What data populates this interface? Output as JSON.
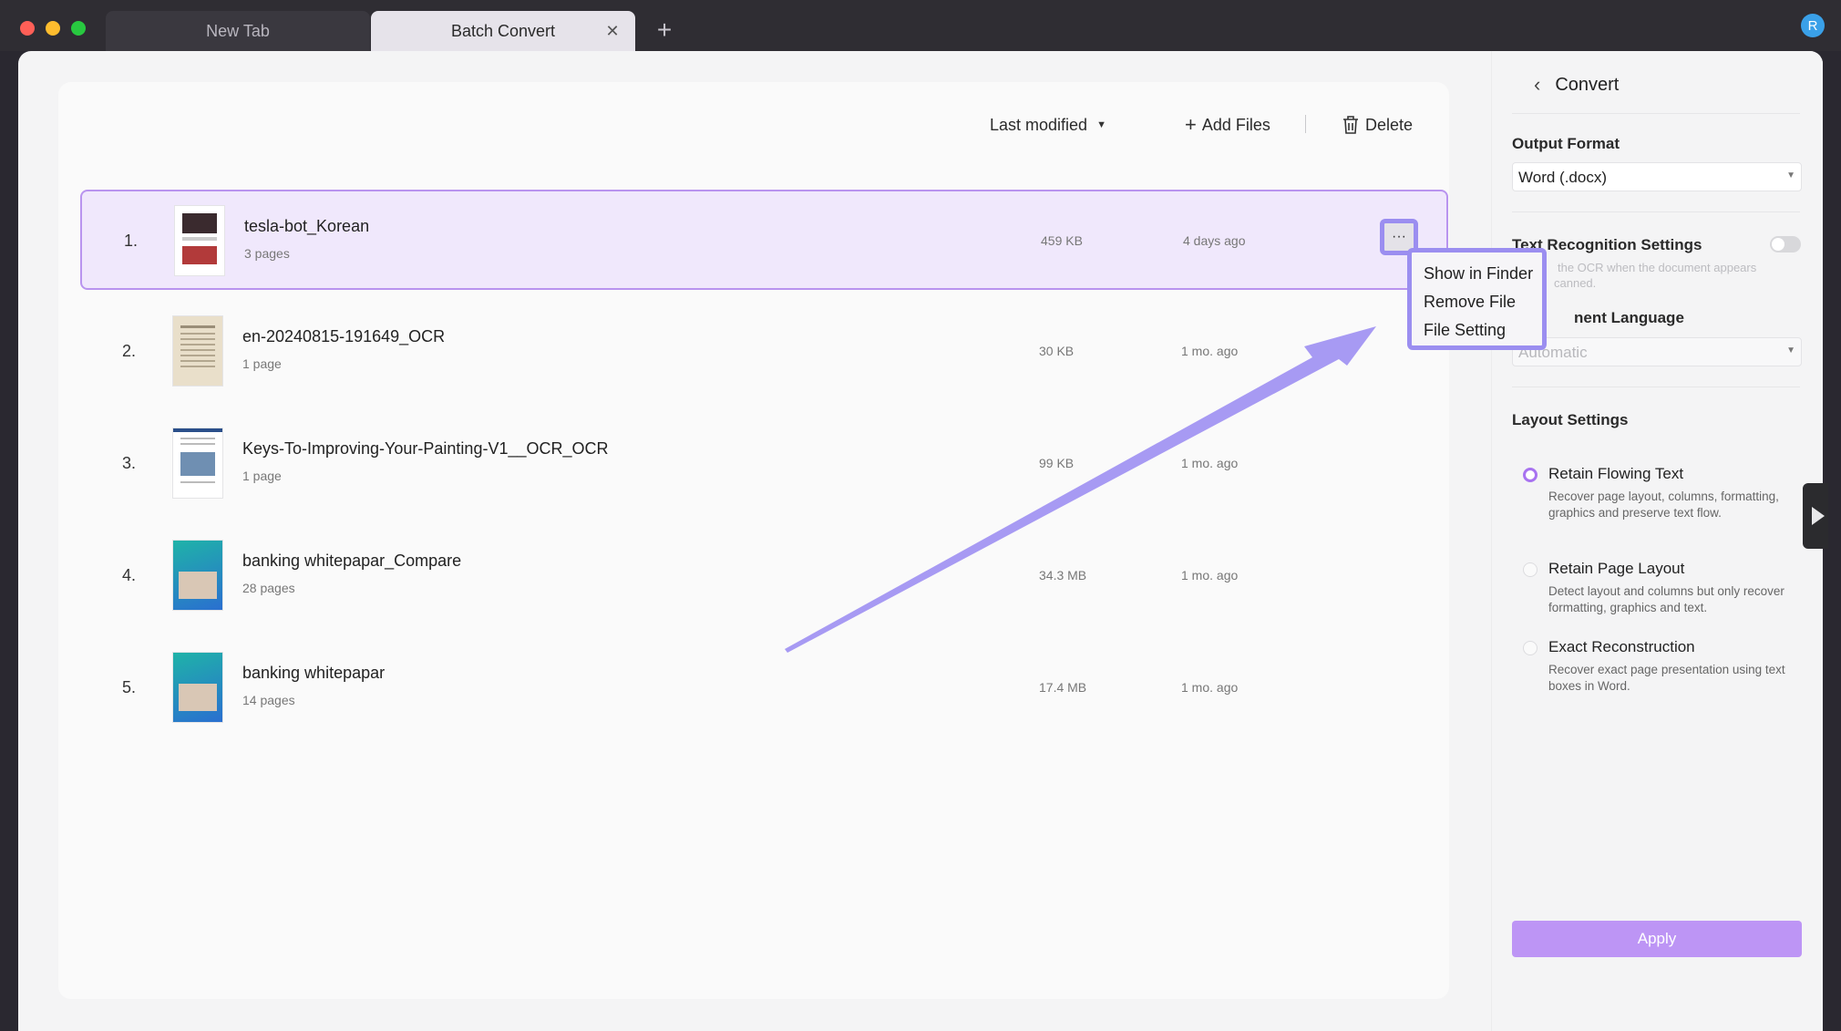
{
  "tabs": [
    {
      "label": "New Tab"
    },
    {
      "label": "Batch Convert",
      "close": "✕"
    }
  ],
  "new_tab": "+",
  "avatar": "R",
  "toolbar": {
    "sort_label": "Last modified",
    "add_files_label": "Add Files",
    "delete_label": "Delete"
  },
  "files": [
    {
      "num": "1.",
      "name": "tesla-bot_Korean",
      "pages": "3 pages",
      "size": "459 KB",
      "date": "4 days ago"
    },
    {
      "num": "2.",
      "name": "en-20240815-191649_OCR",
      "pages": "1 page",
      "size": "30 KB",
      "date": "1 mo. ago"
    },
    {
      "num": "3.",
      "name": "Keys-To-Improving-Your-Painting-V1__OCR_OCR",
      "pages": "1 page",
      "size": "99 KB",
      "date": "1 mo. ago"
    },
    {
      "num": "4.",
      "name": "banking whitepapar_Compare",
      "pages": "28 pages",
      "size": "34.3 MB",
      "date": "1 mo. ago"
    },
    {
      "num": "5.",
      "name": "banking whitepapar",
      "pages": "14 pages",
      "size": "17.4 MB",
      "date": "1 mo. ago"
    }
  ],
  "more_button": "···",
  "context_menu": [
    "Show in Finder",
    "Remove File",
    "File Setting"
  ],
  "side": {
    "title": "Convert",
    "output_format_label": "Output Format",
    "output_format_value": "Word (.docx)",
    "ocr_label": "Text Recognition Settings",
    "ocr_hint_line1": "the OCR when the document appears",
    "ocr_hint_line2": "canned.",
    "language_label": "nent Language",
    "language_value": "Automatic",
    "layout_label": "Layout Settings",
    "options": [
      {
        "title": "Retain Flowing Text",
        "desc": "Recover page layout, columns, formatting, graphics and preserve text flow.",
        "checked": true
      },
      {
        "title": "Retain Page Layout",
        "desc": "Detect layout and columns but only recover formatting, graphics and text.",
        "checked": false
      },
      {
        "title": "Exact Reconstruction",
        "desc": "Recover exact page presentation using text boxes in Word.",
        "checked": false
      }
    ],
    "apply_label": "Apply"
  },
  "colors": {
    "accent": "#b994ef",
    "annotation": "#9b8ef0",
    "apply": "#bd95f5"
  }
}
